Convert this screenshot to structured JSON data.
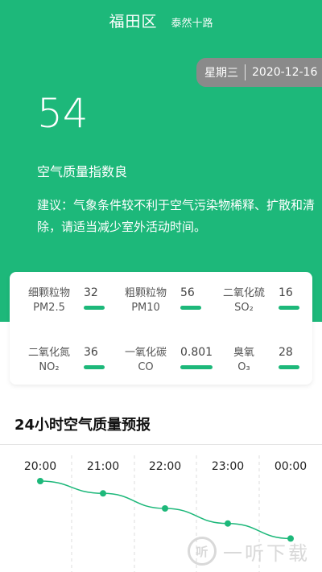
{
  "header": {
    "district": "福田区",
    "street": "泰然十路"
  },
  "date": {
    "weekday": "星期三",
    "date": "2020-12-16"
  },
  "aqi": {
    "value": "54",
    "label": "空气质量指数良",
    "advice": "建议：气象条件较不利于空气污染物稀释、扩散和清除，请适当减少室外活动时间。"
  },
  "pollutants": [
    {
      "name_line1": "细颗粒物",
      "name_line2": "PM2.5",
      "value": "32"
    },
    {
      "name_line1": "粗颗粒物",
      "name_line2": "PM10",
      "value": "56"
    },
    {
      "name_line1": "二氧化硫",
      "name_line2": "SO₂",
      "value": "16"
    },
    {
      "name_line1": "二氧化氮",
      "name_line2": "NO₂",
      "value": "36"
    },
    {
      "name_line1": "一氧化碳",
      "name_line2": "CO",
      "value": "0.801"
    },
    {
      "name_line1": "臭氧",
      "name_line2": "O₃",
      "value": "28"
    }
  ],
  "forecast": {
    "title": "24小时空气质量预报",
    "times": [
      "20:00",
      "21:00",
      "22:00",
      "23:00",
      "00:00"
    ],
    "relative_levels": [
      0.0,
      0.18,
      0.4,
      0.62,
      0.84
    ]
  },
  "watermark": {
    "icon_text": "听",
    "text": "一听下载"
  },
  "colors": {
    "accent": "#1db87a",
    "pill": "#8a8a8a"
  }
}
